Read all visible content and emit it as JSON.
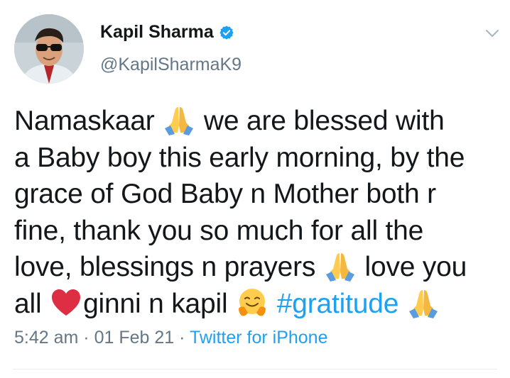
{
  "tweet": {
    "author": {
      "name": "Kapil Sharma",
      "handle": "@KapilSharmaK9",
      "verified": true,
      "avatar_icon": "profile-photo-sunglasses"
    },
    "text": {
      "line1_a": "Namaskaar",
      "line1_b": "we are blessed with",
      "line2": "a Baby boy this early morning, by the",
      "line3": "grace of God Baby n Mother both r",
      "line4": "fine, thank you so much for all the",
      "line5_a": "love, blessings n prayers",
      "line5_b": "love you",
      "line6_a": "all",
      "line6_b": "ginni n kapil",
      "hashtag": "#gratitude",
      "emoji": [
        "folded-hands-icon",
        "red-heart-icon",
        "hugging-face-icon"
      ]
    },
    "meta": {
      "time": "5:42 am",
      "separator": "·",
      "date": "01 Feb 21",
      "source": "Twitter for iPhone"
    }
  },
  "colors": {
    "text": "#14171a",
    "secondary": "#657786",
    "link": "#1da1f2",
    "verified": "#1da1f2",
    "divider": "#e6ecf0"
  },
  "icons": {
    "menu": "chevron-down-icon",
    "verified": "verified-badge-icon"
  }
}
